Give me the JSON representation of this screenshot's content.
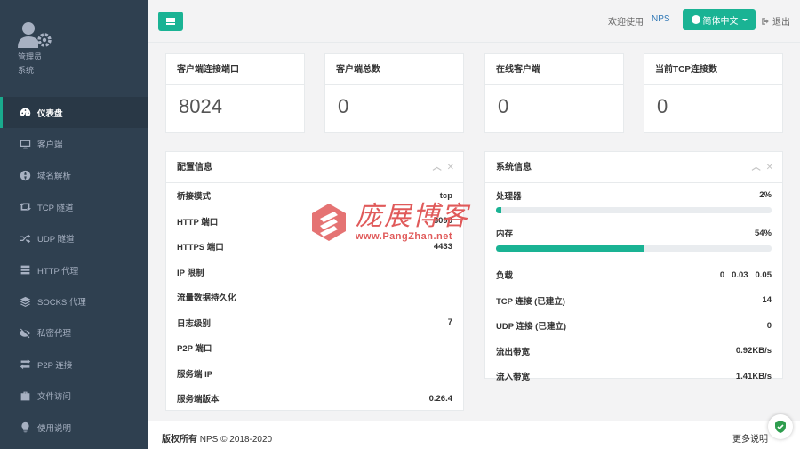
{
  "profile": {
    "name": "管理员",
    "role": "系统"
  },
  "sidebar": {
    "items": [
      {
        "label": "仪表盘",
        "icon": "dashboard-icon"
      },
      {
        "label": "客户端",
        "icon": "monitor-icon"
      },
      {
        "label": "域名解析",
        "icon": "globe-icon"
      },
      {
        "label": "TCP 隧道",
        "icon": "retweet-icon"
      },
      {
        "label": "UDP 隧道",
        "icon": "random-icon"
      },
      {
        "label": "HTTP 代理",
        "icon": "server-icon"
      },
      {
        "label": "SOCKS 代理",
        "icon": "layers-icon"
      },
      {
        "label": "私密代理",
        "icon": "eye-slash-icon"
      },
      {
        "label": "P2P 连接",
        "icon": "exchange-icon"
      },
      {
        "label": "文件访问",
        "icon": "briefcase-icon"
      },
      {
        "label": "使用说明",
        "icon": "lightbulb-icon"
      }
    ]
  },
  "header": {
    "welcome": "欢迎使用",
    "brand": "NPS",
    "language": "简体中文",
    "logout": "退出"
  },
  "stats": [
    {
      "title": "客户端连接端口",
      "value": "8024"
    },
    {
      "title": "客户端总数",
      "value": "0"
    },
    {
      "title": "在线客户端",
      "value": "0"
    },
    {
      "title": "当前TCP连接数",
      "value": "0"
    }
  ],
  "config": {
    "title": "配置信息",
    "rows": [
      {
        "label": "桥接模式",
        "value": "tcp"
      },
      {
        "label": "HTTP 端口",
        "value": "8090"
      },
      {
        "label": "HTTPS 端口",
        "value": "4433"
      },
      {
        "label": "IP 限制",
        "value": ""
      },
      {
        "label": "流量数据持久化",
        "value": ""
      },
      {
        "label": "日志级别",
        "value": "7"
      },
      {
        "label": "P2P 端口",
        "value": ""
      },
      {
        "label": "服务端 IP",
        "value": ""
      },
      {
        "label": "服务端版本",
        "value": "0.26.4"
      }
    ]
  },
  "system": {
    "title": "系统信息",
    "cpu": {
      "label": "处理器",
      "value": "2%",
      "fraction": 0.02
    },
    "memory": {
      "label": "内存",
      "value": "54%",
      "fraction": 0.54
    },
    "rows": [
      {
        "label": "负载",
        "value": "0   0.03   0.05"
      },
      {
        "label": "TCP 连接 (已建立)",
        "value": "14"
      },
      {
        "label": "UDP 连接 (已建立)",
        "value": "0"
      },
      {
        "label": "流出带宽",
        "value": "0.92KB/s"
      },
      {
        "label": "流入带宽",
        "value": "1.41KB/s"
      }
    ]
  },
  "footer": {
    "copyright_label": "版权所有",
    "copyright_text": "NPS © 2018-2020",
    "more": "更多说明"
  },
  "watermark": {
    "text": "庞展博客",
    "url": "www.PangZhan.net"
  },
  "colors": {
    "sidebar_bg": "#2f4050",
    "accent": "#1ab394",
    "link": "#337ab7",
    "watermark": "#e05a5a"
  }
}
